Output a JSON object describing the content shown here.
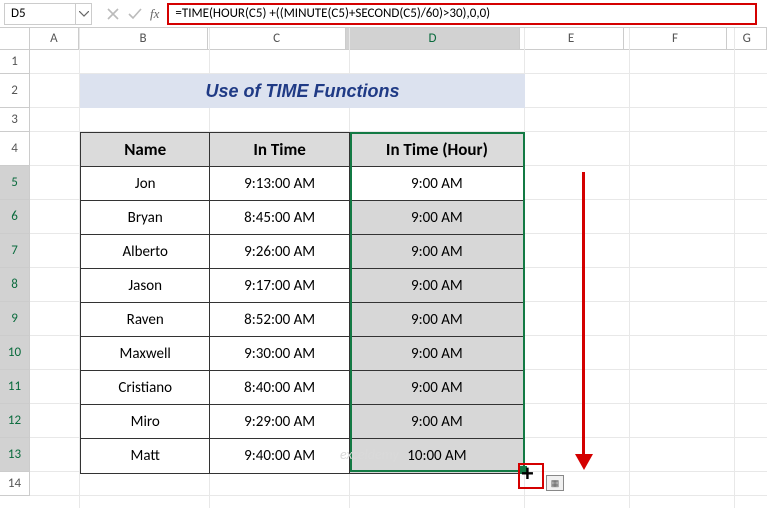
{
  "namebox": "D5",
  "formula": "=TIME(HOUR(C5) +((MINUTE(C5)+SECOND(C5)/60)>30),0,0)",
  "columns": [
    "A",
    "B",
    "C",
    "D",
    "E",
    "F",
    "G"
  ],
  "row_headers": [
    "1",
    "2",
    "3",
    "4",
    "5",
    "6",
    "7",
    "8",
    "9",
    "10",
    "11",
    "12",
    "13",
    "14"
  ],
  "title": "Use of TIME Functions",
  "table": {
    "headers": [
      "Name",
      "In Time",
      "In Time (Hour)"
    ],
    "rows": [
      {
        "name": "Jon",
        "in": "9:13:00 AM",
        "out": "9:00 AM",
        "shade": false
      },
      {
        "name": "Bryan",
        "in": "8:45:00 AM",
        "out": "9:00 AM",
        "shade": true
      },
      {
        "name": "Alberto",
        "in": "9:26:00 AM",
        "out": "9:00 AM",
        "shade": true
      },
      {
        "name": "Jason",
        "in": "9:17:00 AM",
        "out": "9:00 AM",
        "shade": true
      },
      {
        "name": "Raven",
        "in": "8:52:00 AM",
        "out": "9:00 AM",
        "shade": true
      },
      {
        "name": "Maxwell",
        "in": "9:30:00 AM",
        "out": "9:00 AM",
        "shade": true
      },
      {
        "name": "Cristiano",
        "in": "8:40:00 AM",
        "out": "9:00 AM",
        "shade": true
      },
      {
        "name": "Miro",
        "in": "9:29:00 AM",
        "out": "9:00 AM",
        "shade": true
      },
      {
        "name": "Matt",
        "in": "9:40:00 AM",
        "out": "10:00 AM",
        "shade": true
      }
    ]
  },
  "watermark": "exceldemy",
  "autofill_icon": "▦"
}
